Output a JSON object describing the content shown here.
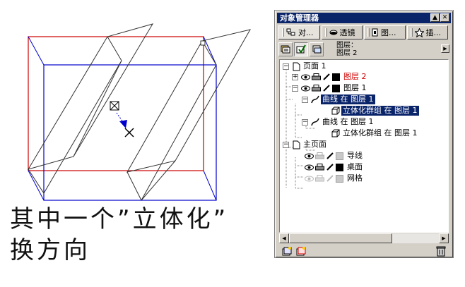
{
  "caption": {
    "line1": "其中一个”立体化”",
    "line2": "换方向"
  },
  "docker": {
    "title": "对象管理器",
    "tabs": [
      {
        "label": "对...",
        "icon": "object-props-icon"
      },
      {
        "label": "透镜",
        "icon": "lens-icon"
      },
      {
        "label": "图...",
        "icon": "bitmap-icon"
      },
      {
        "label": "插...",
        "icon": "star-icon"
      }
    ],
    "layer_label_top": "图层：",
    "layer_label_bottom": "图层 2",
    "tree": {
      "page1": "页面 1",
      "layer2": "图层 2",
      "layer1": "图层 1",
      "curve1": "曲线 在 图层 1",
      "extrude1": "立体化群组 在 图层 1",
      "curve2": "曲线 在 图层 1",
      "extrude2": "立体化群组 在 图层 1",
      "master": "主页面",
      "guides": "导线",
      "desktop": "桌面",
      "grid": "网格"
    }
  },
  "colors": {
    "selection": "#0a246a",
    "active_layer_text": "#d00000",
    "frame_red": "#cc0000",
    "frame_blue": "#0000cc"
  }
}
